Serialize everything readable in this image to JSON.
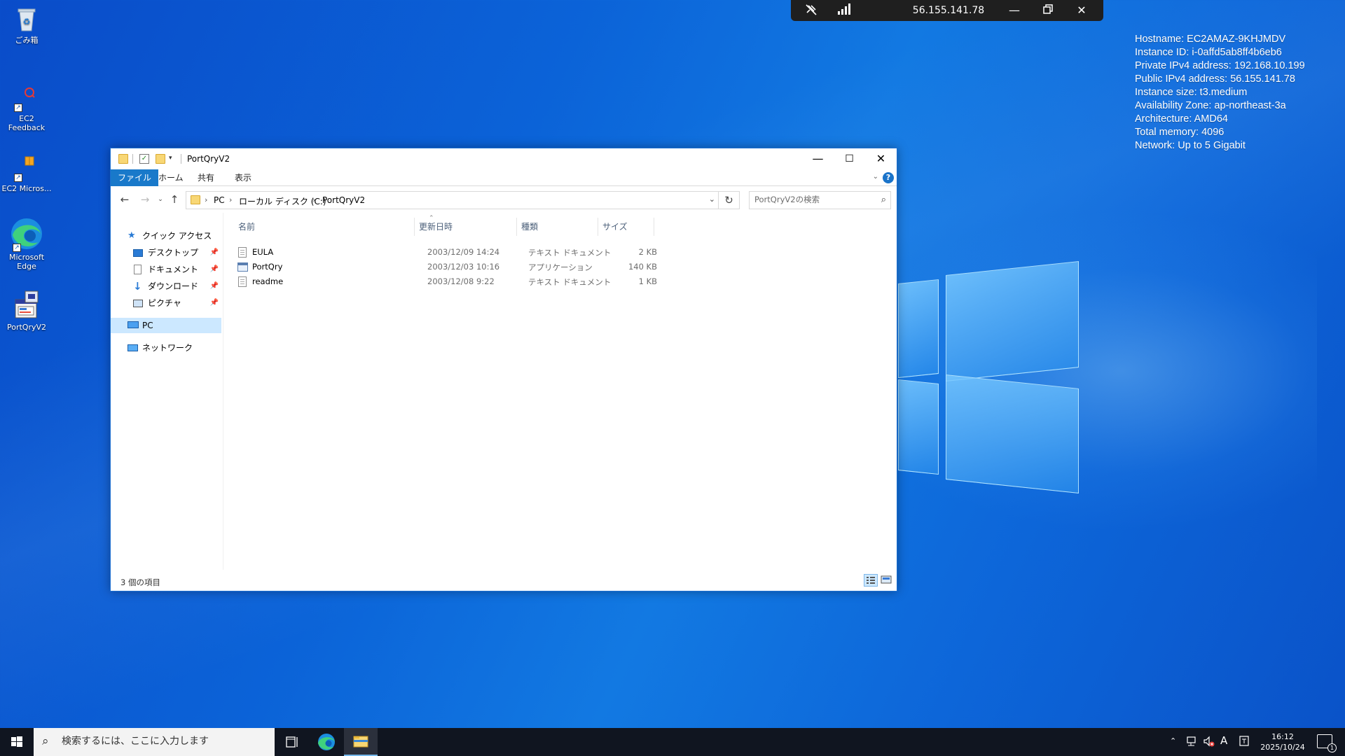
{
  "desktop": {
    "icons": [
      {
        "label": "ごみ箱"
      },
      {
        "label": "EC2 Feedback"
      },
      {
        "label": "EC2 Micros..."
      },
      {
        "label": "Microsoft Edge"
      },
      {
        "label": "PortQryV2"
      }
    ]
  },
  "rdp_bar": {
    "ip": "56.155.141.78"
  },
  "bginfo": {
    "lines": [
      "Hostname: EC2AMAZ-9KHJMDV",
      "Instance ID: i-0affd5ab8ff4b6eb6",
      "Private IPv4 address: 192.168.10.199",
      "Public IPv4 address: 56.155.141.78",
      "Instance size: t3.medium",
      "Availability Zone: ap-northeast-3a",
      "Architecture: AMD64",
      "Total memory: 4096",
      "Network: Up to 5 Gigabit"
    ]
  },
  "explorer": {
    "title": "PortQryV2",
    "ribbon_tabs": [
      "ファイル",
      "ホーム",
      "共有",
      "表示"
    ],
    "breadcrumb": [
      "PC",
      "ローカル ディスク (C:)",
      "PortQryV2"
    ],
    "search_placeholder": "PortQryV2の検索",
    "nav_pane": {
      "quick_access": "クイック アクセス",
      "items": [
        "デスクトップ",
        "ドキュメント",
        "ダウンロード",
        "ピクチャ"
      ],
      "pc": "PC",
      "network": "ネットワーク"
    },
    "columns": [
      "名前",
      "更新日時",
      "種類",
      "サイズ"
    ],
    "files": [
      {
        "name": "EULA",
        "date": "2003/12/09 14:24",
        "type": "テキスト ドキュメント",
        "size": "2 KB"
      },
      {
        "name": "PortQry",
        "date": "2003/12/03 10:16",
        "type": "アプリケーション",
        "size": "140 KB"
      },
      {
        "name": "readme",
        "date": "2003/12/08 9:22",
        "type": "テキスト ドキュメント",
        "size": "1 KB"
      }
    ],
    "status": "3 個の項目"
  },
  "taskbar": {
    "search_placeholder": "検索するには、ここに入力します",
    "ime": "A",
    "time": "16:12",
    "date": "2025/10/24",
    "notification_count": "1"
  }
}
